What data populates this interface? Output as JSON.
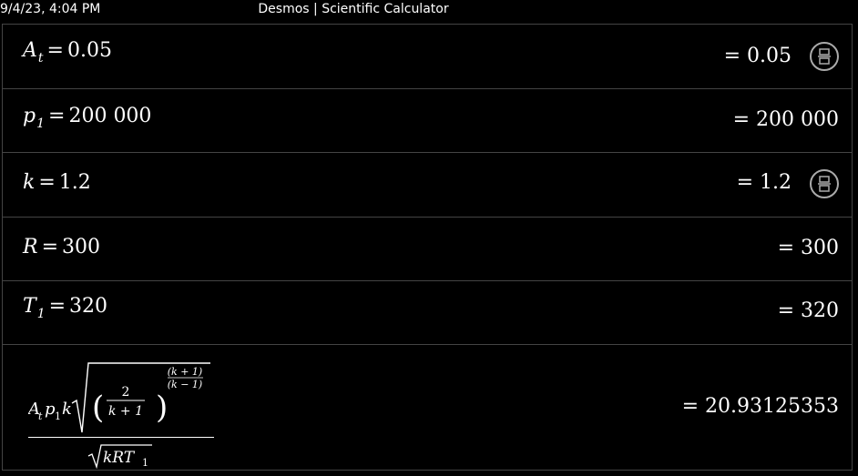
{
  "status_bar": {
    "timestamp": "9/4/23, 4:04 PM",
    "window_title": "Desmos | Scientific Calculator"
  },
  "expressions": [
    {
      "var": "A",
      "sub": "t",
      "value": "0.05",
      "result": "= 0.05",
      "has_fraction_toggle": true
    },
    {
      "var": "p",
      "sub": "1",
      "value": "200 000",
      "result": "= 200 000",
      "has_fraction_toggle": false
    },
    {
      "var": "k",
      "sub": "",
      "value": "1.2",
      "result": "= 1.2",
      "has_fraction_toggle": true
    },
    {
      "var": "R",
      "sub": "",
      "value": "300",
      "result": "= 300",
      "has_fraction_toggle": false
    },
    {
      "var": "T",
      "sub": "1",
      "value": "320",
      "result": "= 320",
      "has_fraction_toggle": false
    }
  ],
  "formula": {
    "numerator_prefix": "A",
    "numerator_prefix_sub": "t",
    "p_var": "p",
    "p_sub": "1",
    "k_var": "k",
    "inner_numerator": "2",
    "inner_denominator": "k + 1",
    "exp_numerator": "(k + 1)",
    "exp_denominator": "(k − 1)",
    "denominator": "kRT",
    "denominator_sub": "1",
    "result": "= 20.93125353"
  },
  "operators": {
    "equals": "="
  },
  "icons": {
    "fraction_toggle": "fraction-toggle-icon"
  }
}
